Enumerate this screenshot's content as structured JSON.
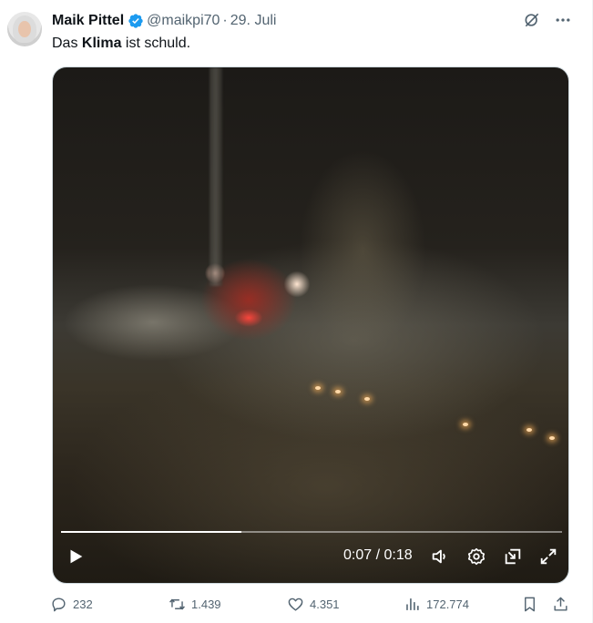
{
  "author": {
    "display_name": "Maik Pittel",
    "handle": "@maikpi70",
    "separator": "·",
    "date": "29. Juli",
    "verified": true
  },
  "tweet": {
    "text_before": "Das ",
    "text_bold": "Klima",
    "text_after": " ist schuld."
  },
  "video": {
    "current_time": "0:07",
    "time_separator": " / ",
    "duration": "0:18",
    "progress_fraction": 0.36
  },
  "stats": {
    "replies": "232",
    "reposts": "1.439",
    "likes": "4.351",
    "views": "172.774"
  },
  "icons": {
    "grok": "grok-icon",
    "more": "more-icon",
    "play": "play-icon",
    "volume": "volume-icon",
    "settings": "gear-icon",
    "pip": "pip-icon",
    "fullscreen": "fullscreen-icon",
    "reply": "reply-icon",
    "repost": "repost-icon",
    "like": "heart-icon",
    "views": "views-icon",
    "bookmark": "bookmark-icon",
    "share": "share-icon"
  },
  "colors": {
    "text": "#0f1419",
    "secondary": "#536471",
    "verified": "#1d9bf0"
  }
}
